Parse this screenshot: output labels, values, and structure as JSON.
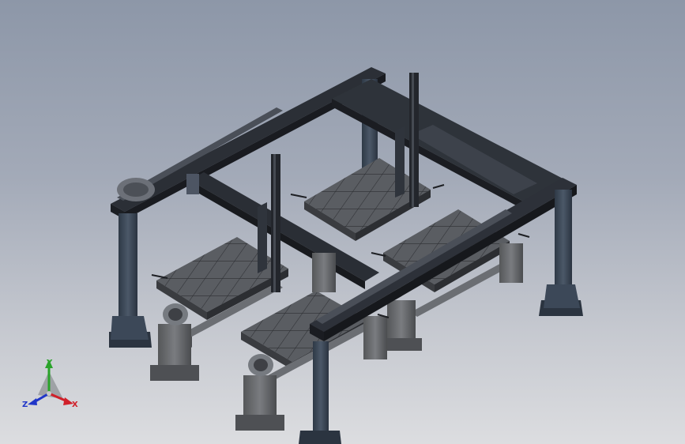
{
  "window": {
    "title": ""
  },
  "triad": {
    "x_label": "X",
    "y_label": "Y",
    "z_label": "Z",
    "x_color": "#d0202a",
    "y_color": "#2aa32a",
    "z_color": "#2036c8"
  },
  "model": {
    "icon": "gantry-welding-cell-icon",
    "colors": {
      "frame": "#3b4654",
      "rail": "#1e2026",
      "plate": "#5b5e64",
      "pedestal": "#6d6f73"
    }
  }
}
